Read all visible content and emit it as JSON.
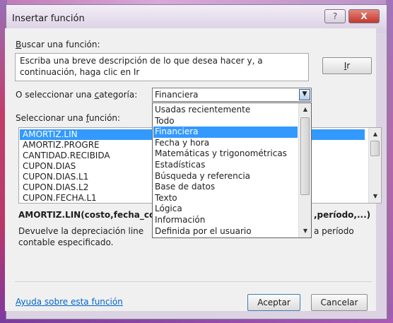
{
  "dialog": {
    "title": "Insertar función",
    "help_glyph": "?",
    "close_glyph": "X"
  },
  "search": {
    "label_first": "B",
    "label_rest": "uscar una función:",
    "description_line1": "Escriba una breve descripción de lo que desea hacer y, a",
    "description_line2": "continuación, haga clic en Ir",
    "go_first": "I",
    "go_rest": "r"
  },
  "category": {
    "label_pre": "O seleccionar una ",
    "label_key": "c",
    "label_post": "ategoría:",
    "selected": "Financiera",
    "options": [
      "Usadas recientemente",
      "Todo",
      "Financiera",
      "Fecha y hora",
      "Matemáticas y trigonométricas",
      "Estadísticas",
      "Búsqueda y referencia",
      "Base de datos",
      "Texto",
      "Lógica",
      "Información",
      "Definida por el usuario"
    ],
    "selected_index": 2
  },
  "function_list": {
    "label_pre": "Seleccionar una ",
    "label_key": "f",
    "label_post": "unción:",
    "items": [
      "AMORTIZ.LIN",
      "AMORTIZ.PROGRE",
      "CANTIDAD.RECIBIDA",
      "CUPON.DIAS",
      "CUPON.DIAS.L1",
      "CUPON.DIAS.L2",
      "CUPON.FECHA.L1"
    ],
    "selected_index": 0
  },
  "syntax": {
    "left": "AMORTIZ.LIN(costo,fecha_co",
    "right": ",período,...)"
  },
  "description": {
    "line1_left": "Devuelve la depreciación line",
    "line1_right": "a período",
    "line2": "contable especificado."
  },
  "footer": {
    "help_link": "Ayuda sobre esta función",
    "ok_label": "Aceptar",
    "cancel_label": "Cancelar"
  },
  "colors": {
    "selection": "#3399ff",
    "link": "#0066cc"
  }
}
